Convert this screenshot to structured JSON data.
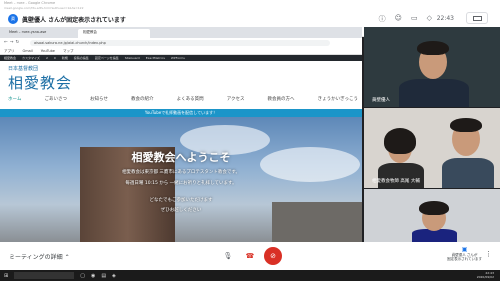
{
  "meet": {
    "window_title": "Meet – rvee - Google Chrome",
    "window_url": "meet.google.com/fds-sdfs-hrm?authuser=1&hs=122",
    "presenter_initial": "眞",
    "presenting_banner": "眞壁優人 さんが固定表示されています",
    "time": "22:43",
    "meeting_details": "ミーティングの詳細",
    "pinned_label": "眞壁優人 さんが\n固定表示されています"
  },
  "browser": {
    "tabs": [
      "Meet – rvee-ysna-ase",
      "相愛教会"
    ],
    "url": "aisoai.sakura.ne.jp/aiai-church/index.php",
    "bookmarks": [
      "アプリ",
      "Gmail",
      "YouTube",
      "マップ"
    ],
    "wp_items": [
      "相愛教会",
      "カスタマイズ",
      "2",
      "0",
      "新規",
      "投稿の編集",
      "固定ページを編集",
      "SiteGuard",
      "ExactMetrics",
      "WPForms"
    ]
  },
  "site": {
    "subtitle": "日本基督教団",
    "title": "相愛教会",
    "nav": [
      "ホーム",
      "ごあいさつ",
      "お知らせ",
      "教会の紹介",
      "よくある質問",
      "アクセス",
      "教会員の方へ",
      "きょうかいぎっこう"
    ],
    "youtube_banner": "YouTubeで礼拝動画を配信しています！",
    "hero_title": "相愛教会へようこそ",
    "hero_line1": "相愛教会は東京都 三鷹市にあるプロテスタント教会です。",
    "hero_line2": "毎週日曜 10:15 から 一緒にお祈りと礼拝しています。",
    "hero_line3": "どなたでもご参加いただけます",
    "hero_line4": "ぜひお越しください"
  },
  "participants": [
    {
      "name": "眞壁優人"
    },
    {
      "name": "相愛教会牧師 高尾 大輔"
    },
    {
      "name": ""
    }
  ],
  "taskbar": {
    "time": "22:43",
    "date": "2020/09/02"
  }
}
